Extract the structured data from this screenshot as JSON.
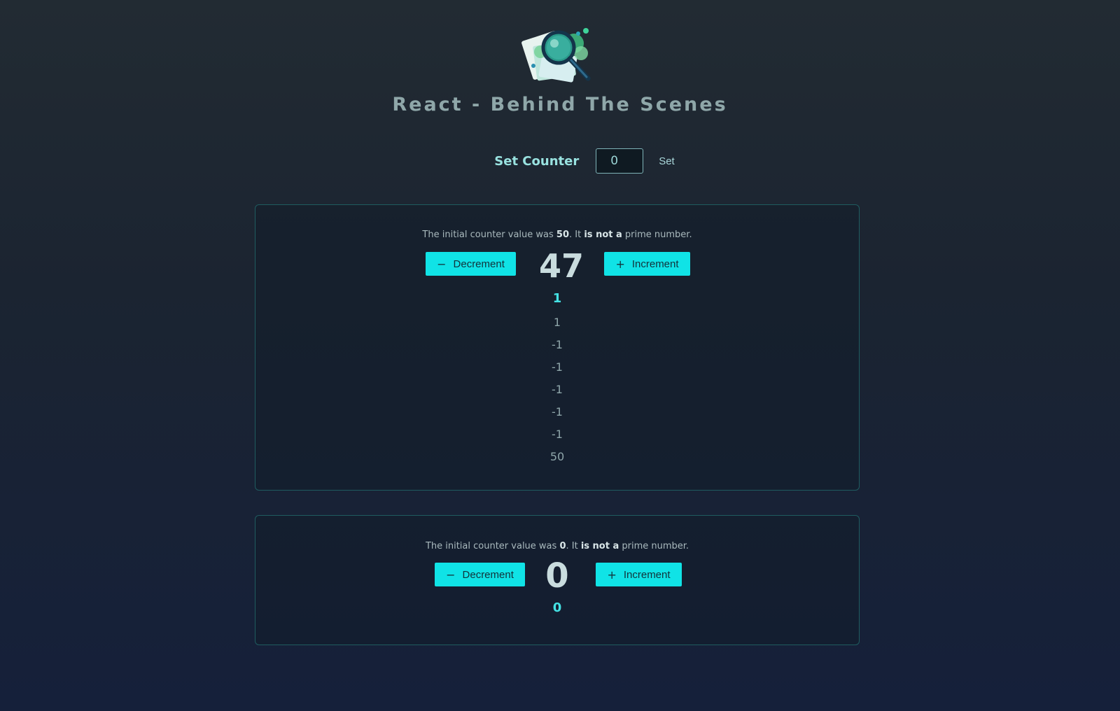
{
  "header": {
    "title": "React - Behind The Scenes",
    "logo_icon": "magnifying-glass-documents-logo"
  },
  "set_counter": {
    "label": "Set Counter",
    "input_value": "0",
    "button_label": "Set"
  },
  "counters": [
    {
      "info_prefix": "The initial counter value was ",
      "initial_value": "50",
      "info_middle": ". It ",
      "info_emphasis": "is not a",
      "info_suffix": " prime number.",
      "decrement_label": "Decrement",
      "increment_label": "Increment",
      "current_value": "47",
      "history": [
        "1",
        "1",
        "-1",
        "-1",
        "-1",
        "-1",
        "-1",
        "50"
      ]
    },
    {
      "info_prefix": "The initial counter value was ",
      "initial_value": "0",
      "info_middle": ". It ",
      "info_emphasis": "is not a",
      "info_suffix": " prime number.",
      "decrement_label": "Decrement",
      "increment_label": "Increment",
      "current_value": "0",
      "history": [
        "0"
      ]
    }
  ],
  "colors": {
    "accent": "#10e3e6",
    "history_current": "#44e2e4",
    "card_border": "#1f5c60"
  },
  "icons": {
    "decrement": "minus-icon",
    "increment": "plus-icon"
  }
}
